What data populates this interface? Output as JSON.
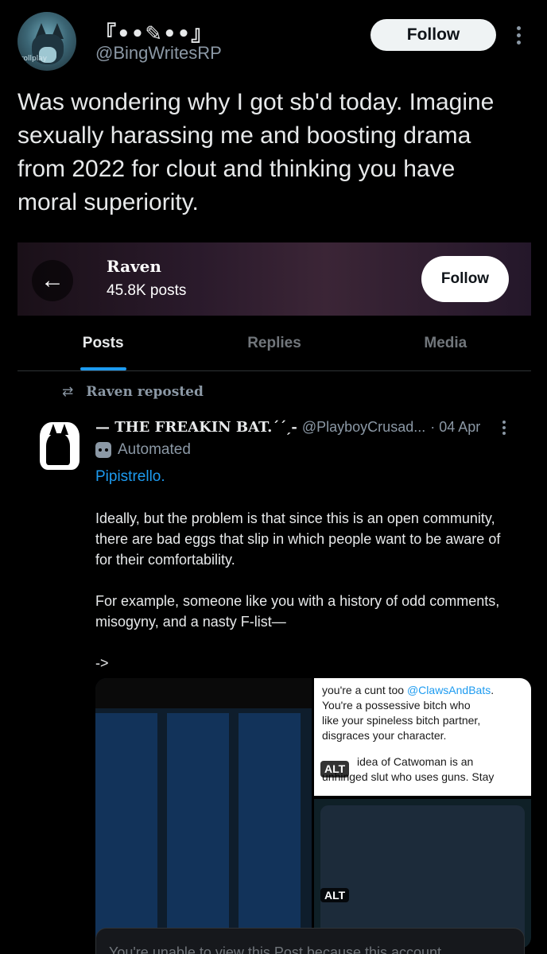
{
  "outer": {
    "display_name": "『••✎••』",
    "handle": "@BingWritesRP",
    "follow_label": "Follow",
    "avatar_text": "rollplay",
    "text": "Was wondering why I got sb'd today. Imagine sexually harassing me and boosting drama from 2022 for clout and thinking you have moral superiority."
  },
  "embed": {
    "back_icon": "←",
    "profile_name": "Raven",
    "post_count": "45.8K posts",
    "follow_label": "Follow",
    "tabs": [
      {
        "label": "Posts",
        "active": true
      },
      {
        "label": "Replies",
        "active": false
      },
      {
        "label": "Media",
        "active": false
      }
    ],
    "repost": {
      "icon": "repost-icon",
      "text": "Raven reposted"
    },
    "post": {
      "name": "— THE FREAKIN BAT.´´ˏ-",
      "handle": "@PlayboyCrusad...",
      "date": "· 04 Apr",
      "automated_label": "Automated",
      "reply_to": "Pipistrello.",
      "paragraphs": [
        "Ideally, but the problem is that since this is an open community, there are bad eggs that slip in which people want to be aware of for their comfortability.",
        "For example, someone like you with a history of odd comments, misogyny, and a nasty F-list—",
        "->"
      ],
      "image_top_right": {
        "line1_prefix": "you're a cunt too ",
        "line1_mention": "@ClawsAndBats",
        "line1_suffix": ".",
        "lines": [
          "You're a possessive bitch who",
          "like your spineless bitch partner,",
          "disgraces your character."
        ],
        "after_alt": "idea of Catwoman is an",
        "last_line": "unhinged slut who uses guns. Stay",
        "alt": "ALT"
      },
      "image_bottom_right": {
        "alt": "ALT"
      },
      "unavailable_text": "You're unable to view this Post because this account"
    }
  }
}
